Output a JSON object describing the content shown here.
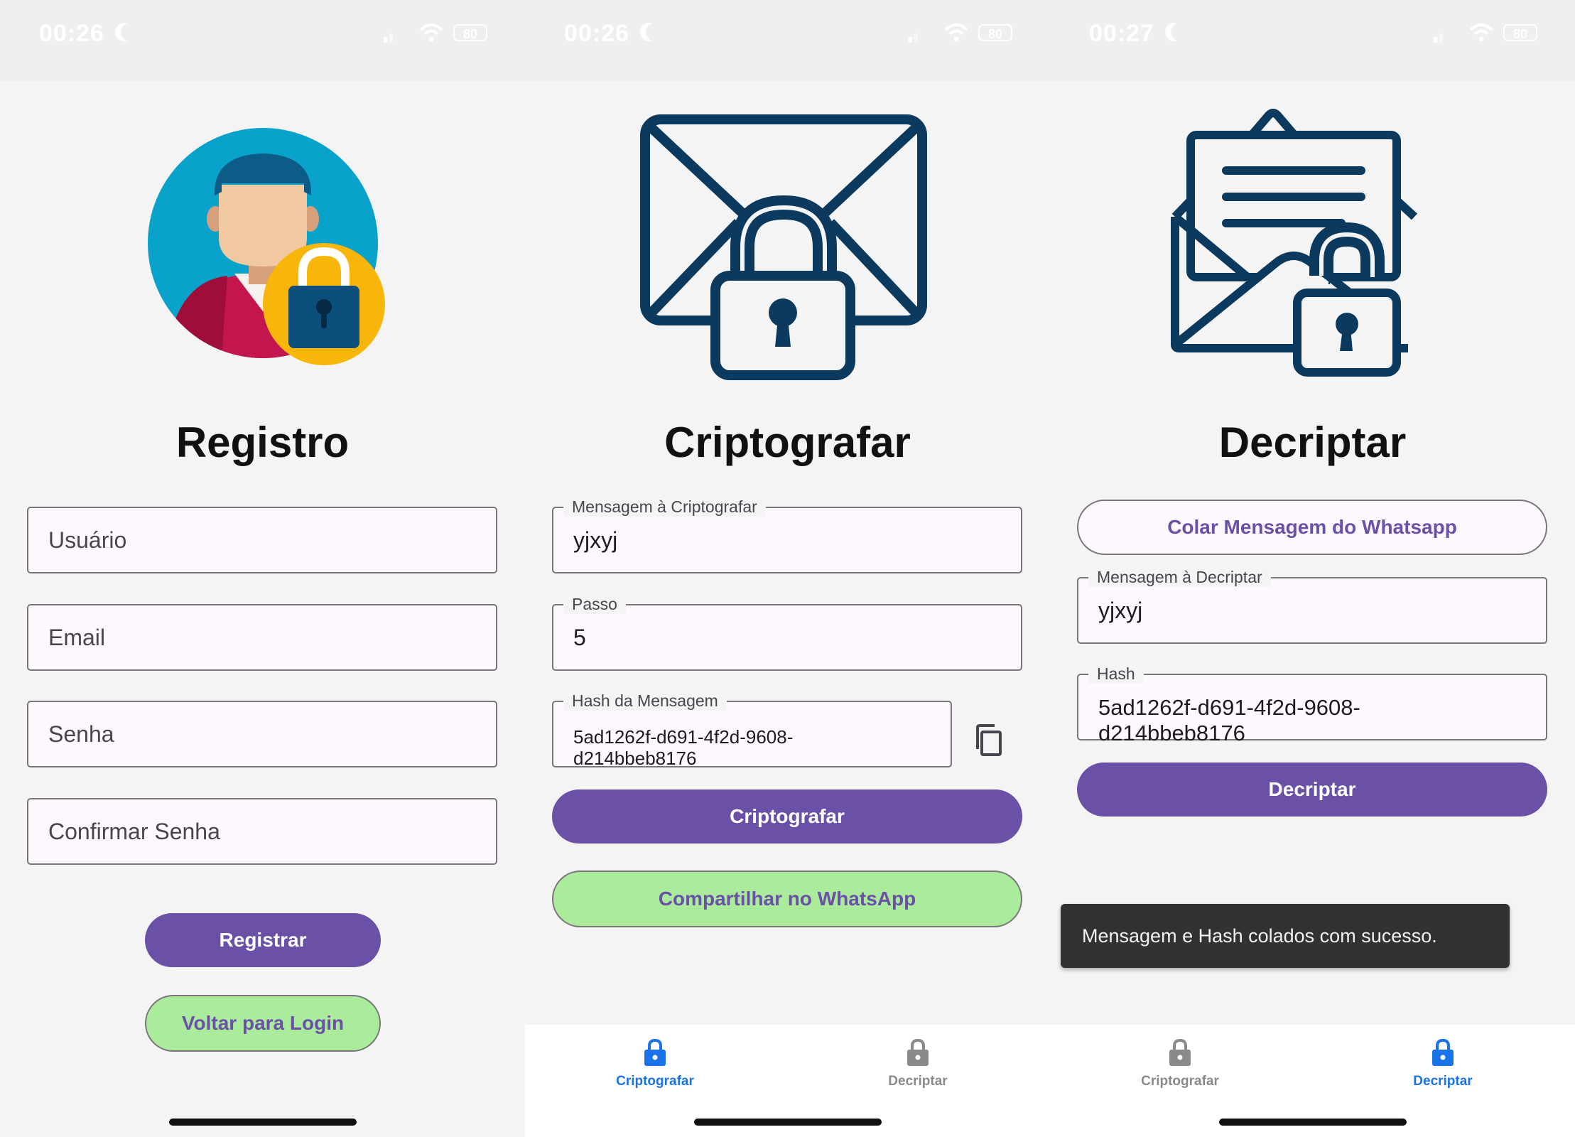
{
  "screens": [
    {
      "status": {
        "time": "00:26",
        "battery": "80"
      },
      "title": "Registro",
      "fields": [
        {
          "placeholder": "Usuário"
        },
        {
          "placeholder": "Email"
        },
        {
          "placeholder": "Senha"
        },
        {
          "placeholder": "Confirmar Senha"
        }
      ],
      "buttons": {
        "register": "Registrar",
        "back_to_login": "Voltar para Login"
      }
    },
    {
      "status": {
        "time": "00:26",
        "battery": "80"
      },
      "title": "Criptografar",
      "fields": [
        {
          "label": "Mensagem à Criptografar",
          "value": "yjxyj"
        },
        {
          "label": "Passo",
          "value": "5"
        },
        {
          "label": "Hash da Mensagem",
          "value": "5ad1262f-d691-4f2d-9608-\nd214bbeb8176"
        }
      ],
      "buttons": {
        "encrypt": "Criptografar",
        "share": "Compartilhar no WhatsApp"
      },
      "tabs": {
        "left": "Criptografar",
        "right": "Decriptar",
        "active": "left"
      }
    },
    {
      "status": {
        "time": "00:27",
        "battery": "80"
      },
      "title": "Decriptar",
      "buttons": {
        "paste": "Colar Mensagem do Whatsapp",
        "decrypt": "Decriptar"
      },
      "fields": [
        {
          "label": "Mensagem à Decriptar",
          "value": "yjxyj"
        },
        {
          "label": "Hash",
          "value": "5ad1262f-d691-4f2d-9608-\nd214bbeb8176"
        }
      ],
      "snackbar": "Mensagem e Hash colados com sucesso.",
      "tabs": {
        "left": "Criptografar",
        "right": "Decriptar",
        "active": "right"
      }
    }
  ],
  "colors": {
    "primary_purple": "#6a50a7",
    "green_button": "#abeb9c",
    "active_tab_blue": "#1a73e8",
    "inactive_tab_gray": "#8a8a8a",
    "icon_navy": "#0b3a5e",
    "avatar_circle": "#08a2cb",
    "lock_yellow": "#f8b60a"
  }
}
